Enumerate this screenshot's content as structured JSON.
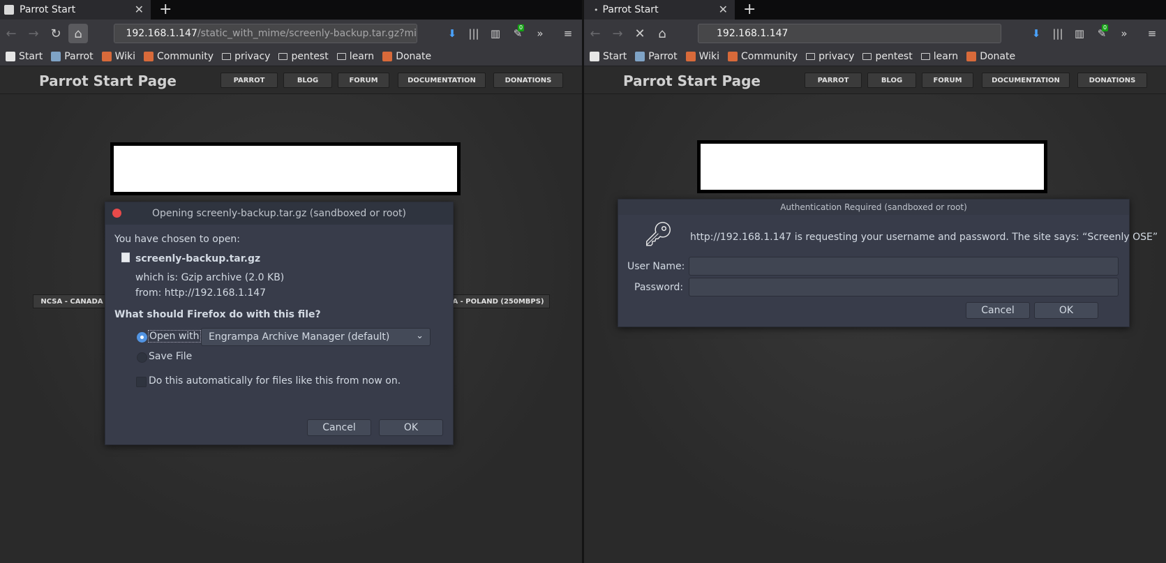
{
  "left": {
    "tab_title": "Parrot Start",
    "url_host": "192.168.1.147",
    "url_path": "/static_with_mime/screenly-backup.tar.gz?mi",
    "badge": "0",
    "bookmarks": [
      "Start",
      "Parrot",
      "Wiki",
      "Community",
      "privacy",
      "pentest",
      "learn",
      "Donate"
    ],
    "page_title": "Parrot Start Page",
    "nav": [
      "PARROT",
      "BLOG",
      "FORUM",
      "DOCUMENTATION",
      "DONATIONS"
    ],
    "mirror_left": "NCSA - CANADA",
    "mirror_right": "A - POLAND (250MBPS)",
    "dialog": {
      "title": "Opening screenly-backup.tar.gz (sandboxed or root)",
      "chosen": "You have chosen to open:",
      "filename": "screenly-backup.tar.gz",
      "which_is": "which is:  Gzip archive (2.0 KB)",
      "from": "from:  http://192.168.1.147",
      "question": "What should Firefox do with this file?",
      "open_with": "Open with",
      "app": "Engrampa Archive Manager (default)",
      "save_file": "Save File",
      "auto": "Do this automatically for files like this from now on.",
      "cancel": "Cancel",
      "ok": "OK"
    }
  },
  "right": {
    "tab_title": "Parrot Start",
    "url_host": "192.168.1.147",
    "badge": "0",
    "bookmarks": [
      "Start",
      "Parrot",
      "Wiki",
      "Community",
      "privacy",
      "pentest",
      "learn",
      "Donate"
    ],
    "page_title": "Parrot Start Page",
    "nav": [
      "PARROT",
      "BLOG",
      "FORUM",
      "DOCUMENTATION",
      "DONATIONS"
    ],
    "dialog": {
      "title": "Authentication Required (sandboxed or root)",
      "message": "http://192.168.1.147 is requesting your username and password. The site says: “Screenly OSE”",
      "user_label": "User Name:",
      "pass_label": "Password:",
      "user_value": "",
      "pass_value": "",
      "cancel": "Cancel",
      "ok": "OK"
    }
  }
}
